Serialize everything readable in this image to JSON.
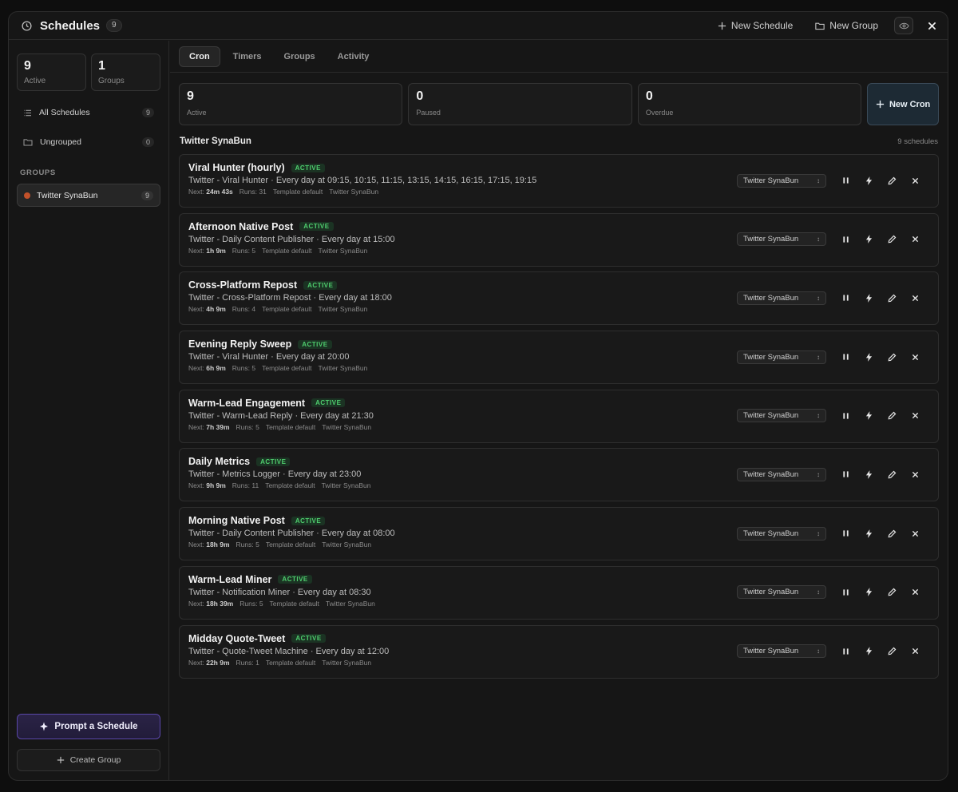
{
  "header": {
    "title": "Schedules",
    "count": "9",
    "new_schedule": "New Schedule",
    "new_group": "New Group"
  },
  "sidebar": {
    "active_count": "9",
    "active_label": "Active",
    "groups_count": "1",
    "groups_label": "Groups",
    "items": [
      {
        "label": "All Schedules",
        "count": "9",
        "icon": "list-icon"
      },
      {
        "label": "Ungrouped",
        "count": "0",
        "icon": "folder-icon"
      }
    ],
    "groups_heading": "GROUPS",
    "groups": [
      {
        "label": "Twitter SynaBun",
        "count": "9",
        "color": "#c2512a"
      }
    ],
    "prompt_button": "Prompt a Schedule",
    "create_group_button": "Create Group"
  },
  "tabs": [
    "Cron",
    "Timers",
    "Groups",
    "Activity"
  ],
  "summary": {
    "active": {
      "value": "9",
      "label": "Active"
    },
    "paused": {
      "value": "0",
      "label": "Paused"
    },
    "overdue": {
      "value": "0",
      "label": "Overdue"
    },
    "new_cron": "New Cron"
  },
  "group": {
    "name": "Twitter SynaBun",
    "count_label": "9 schedules"
  },
  "schedules": [
    {
      "name": "Viral Hunter (hourly)",
      "status": "ACTIVE",
      "desc": "Twitter - Viral Hunter · Every day at 09:15, 10:15, 11:15, 13:15, 14:15, 16:15, 17:15, 19:15",
      "next_label": "Next:",
      "next": "24m 43s",
      "runs": "Runs: 31",
      "template": "Template default",
      "group": "Twitter SynaBun"
    },
    {
      "name": "Afternoon Native Post",
      "status": "ACTIVE",
      "desc": "Twitter - Daily Content Publisher · Every day at 15:00",
      "next_label": "Next:",
      "next": "1h 9m",
      "runs": "Runs: 5",
      "template": "Template default",
      "group": "Twitter SynaBun"
    },
    {
      "name": "Cross-Platform Repost",
      "status": "ACTIVE",
      "desc": "Twitter - Cross-Platform Repost · Every day at 18:00",
      "next_label": "Next:",
      "next": "4h 9m",
      "runs": "Runs: 4",
      "template": "Template default",
      "group": "Twitter SynaBun"
    },
    {
      "name": "Evening Reply Sweep",
      "status": "ACTIVE",
      "desc": "Twitter - Viral Hunter · Every day at 20:00",
      "next_label": "Next:",
      "next": "6h 9m",
      "runs": "Runs: 5",
      "template": "Template default",
      "group": "Twitter SynaBun"
    },
    {
      "name": "Warm-Lead Engagement",
      "status": "ACTIVE",
      "desc": "Twitter - Warm-Lead Reply · Every day at 21:30",
      "next_label": "Next:",
      "next": "7h 39m",
      "runs": "Runs: 5",
      "template": "Template default",
      "group": "Twitter SynaBun"
    },
    {
      "name": "Daily Metrics",
      "status": "ACTIVE",
      "desc": "Twitter - Metrics Logger · Every day at 23:00",
      "next_label": "Next:",
      "next": "9h 9m",
      "runs": "Runs: 11",
      "template": "Template default",
      "group": "Twitter SynaBun"
    },
    {
      "name": "Morning Native Post",
      "status": "ACTIVE",
      "desc": "Twitter - Daily Content Publisher · Every day at 08:00",
      "next_label": "Next:",
      "next": "18h 9m",
      "runs": "Runs: 5",
      "template": "Template default",
      "group": "Twitter SynaBun"
    },
    {
      "name": "Warm-Lead Miner",
      "status": "ACTIVE",
      "desc": "Twitter - Notification Miner · Every day at 08:30",
      "next_label": "Next:",
      "next": "18h 39m",
      "runs": "Runs: 5",
      "template": "Template default",
      "group": "Twitter SynaBun"
    },
    {
      "name": "Midday Quote-Tweet",
      "status": "ACTIVE",
      "desc": "Twitter - Quote-Tweet Machine · Every day at 12:00",
      "next_label": "Next:",
      "next": "22h 9m",
      "runs": "Runs: 1",
      "template": "Template default",
      "group": "Twitter SynaBun"
    }
  ]
}
